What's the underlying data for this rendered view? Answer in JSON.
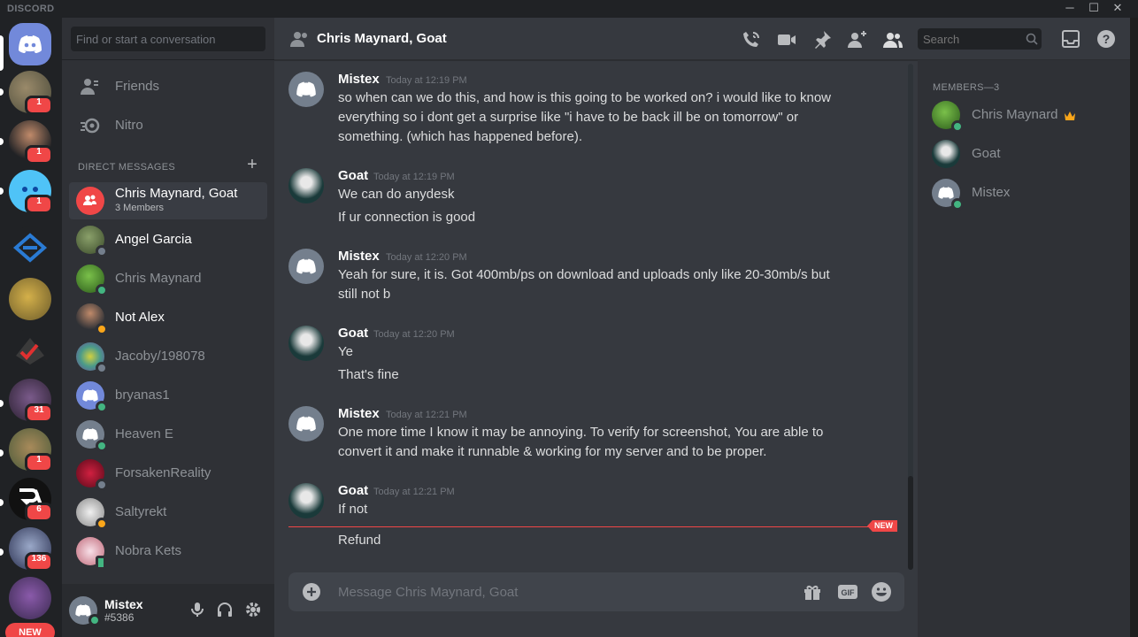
{
  "app": {
    "wordmark": "DISCORD"
  },
  "window_controls": {
    "minimize": "─",
    "maximize": "☐",
    "close": "✕"
  },
  "servers": {
    "new_label": "NEW",
    "badges": [
      "1",
      "1",
      "1",
      "31",
      "1",
      "6",
      "136"
    ],
    "icons": [
      "discord-home-icon",
      "cat-avatar",
      "person-avatar",
      "blue-emoji-avatar",
      "triangle-logo",
      "yellow-food-avatar",
      "rune-list-logo",
      "dark-knight-avatar",
      "cat-meme-avatar",
      "ra-logo",
      "blue-creature-avatar",
      "rz-logo"
    ]
  },
  "dm_panel": {
    "search_placeholder": "Find or start a conversation",
    "nav": [
      {
        "label": "Friends",
        "icon": "friends-icon"
      },
      {
        "label": "Nitro",
        "icon": "nitro-icon"
      }
    ],
    "header": "DIRECT MESSAGES",
    "add": "+",
    "items": [
      {
        "name": "Chris Maynard, Goat",
        "sub": "3 Members",
        "active": true,
        "color": "#f04747"
      },
      {
        "name": "Angel Garcia",
        "status": "offline",
        "color": "#5b7a4a"
      },
      {
        "name": "Chris Maynard",
        "status": "online",
        "color": "#4a8a2a"
      },
      {
        "name": "Not Alex",
        "status": "idle",
        "color": "#2b2b2b"
      },
      {
        "name": "Jacoby/198078",
        "status": "offline",
        "color": "#6a9a6a"
      },
      {
        "name": "bryanas1",
        "status": "online",
        "color": "#7289da"
      },
      {
        "name": "Heaven E",
        "status": "online",
        "color": "#747f8d"
      },
      {
        "name": "ForsakenReality",
        "status": "offline",
        "color": "#9a1a2a"
      },
      {
        "name": "Saltyrekt",
        "status": "idle",
        "color": "#cfcfcf"
      },
      {
        "name": "Nobra Kets",
        "status": "mobile",
        "color": "#e8c0c8"
      }
    ]
  },
  "user_panel": {
    "name": "Mistex",
    "tag": "#5386"
  },
  "chat": {
    "title": "Chris Maynard, Goat",
    "search_placeholder": "Search",
    "composer_placeholder": "Message Chris Maynard, Goat",
    "new_label": "NEW",
    "messages": [
      {
        "author": "Mistex",
        "time": "Today at 12:19 PM",
        "avatar": "discord",
        "lines": [
          "so when can we do this, and how is this going to be worked on? i would like to know",
          "everything so i dont get a surprise like \"i have to be back ill be on tomorrow\" or",
          "something. (which has happened before)."
        ]
      },
      {
        "author": "Goat",
        "time": "Today at 12:19 PM",
        "avatar": "goat",
        "lines": [
          "We can do anydesk",
          "If ur connection is good"
        ]
      },
      {
        "author": "Mistex",
        "time": "Today at 12:20 PM",
        "avatar": "discord",
        "lines": [
          "Yeah for sure, it is. Got 400mb/ps on download and uploads only like 20-30mb/s but",
          "still not b"
        ]
      },
      {
        "author": "Goat",
        "time": "Today at 12:20 PM",
        "avatar": "goat",
        "lines": [
          "Ye",
          "That's fine"
        ]
      },
      {
        "author": "Mistex",
        "time": "Today at 12:21 PM",
        "avatar": "discord",
        "lines": [
          "One more time I know it may be annoying. To verify for screenshot, You are able to",
          "convert it and make it runnable & working for my server and to be proper."
        ]
      },
      {
        "author": "Goat",
        "time": "Today at 12:21 PM",
        "avatar": "goat",
        "lines": [
          "If not",
          "Refund"
        ]
      }
    ]
  },
  "members": {
    "header": "MEMBERS—3",
    "owner_icon": "crown-icon",
    "list": [
      {
        "name": "Chris Maynard",
        "owner": true,
        "status": "online",
        "color": "#4a8a2a"
      },
      {
        "name": "Goat",
        "owner": false,
        "status": "none",
        "color": "#1a3a3a"
      },
      {
        "name": "Mistex",
        "owner": false,
        "status": "online",
        "color": "#747f8d"
      }
    ]
  },
  "colors": {
    "online": "#43b581",
    "idle": "#faa61a",
    "offline": "#747f8d",
    "accent": "#7289da",
    "red": "#f04747"
  }
}
